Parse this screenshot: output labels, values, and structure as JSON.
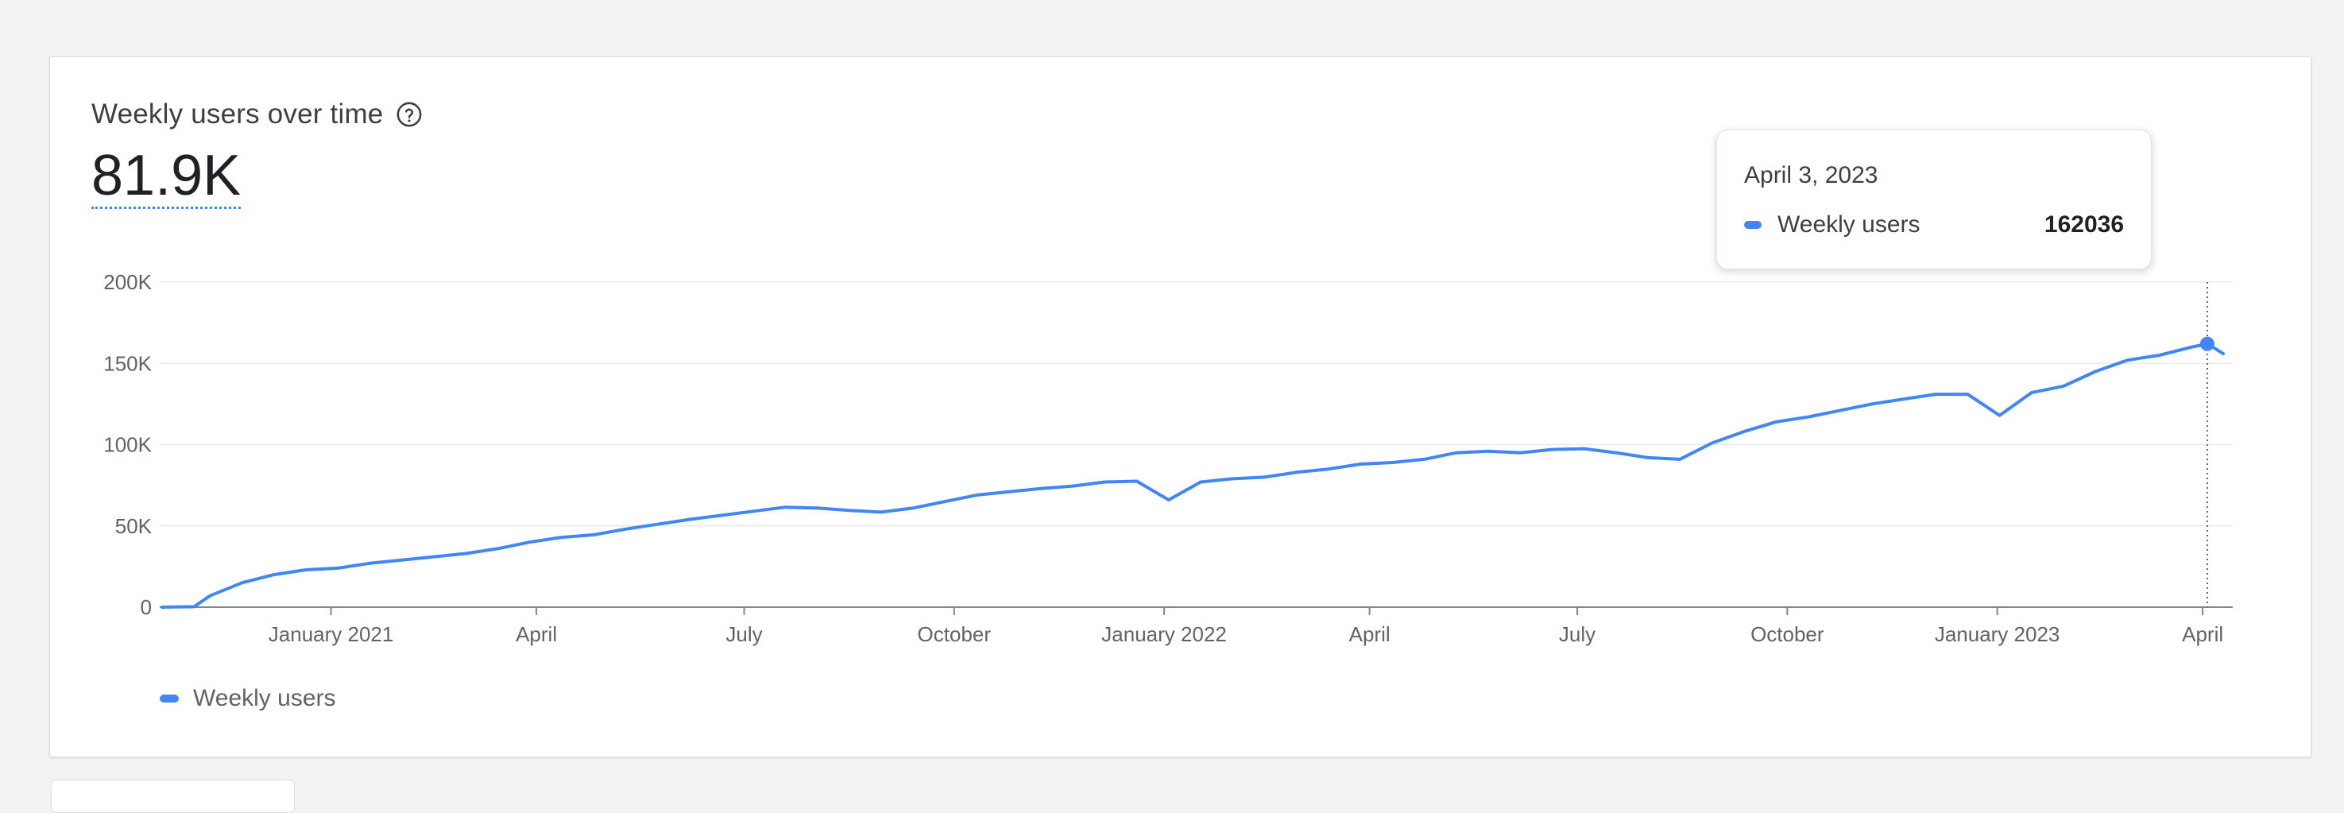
{
  "card": {
    "title": "Weekly users over time",
    "headline_value": "81.9K"
  },
  "tooltip": {
    "date": "April 3, 2023",
    "series": "Weekly users",
    "value": "162036"
  },
  "legend": {
    "label": "Weekly users"
  },
  "colors": {
    "series": "#4285f4",
    "grid": "#e8eaed",
    "axis": "#80868b"
  },
  "icons": {
    "help": "help-circle-icon"
  },
  "chart_data": {
    "type": "line",
    "ylim": [
      0,
      200000
    ],
    "y_ticks": [
      {
        "value": 0,
        "label": "0"
      },
      {
        "value": 50000,
        "label": "50K"
      },
      {
        "value": 100000,
        "label": "100K"
      },
      {
        "value": 150000,
        "label": "150K"
      },
      {
        "value": 200000,
        "label": "200K"
      }
    ],
    "x_range": [
      "2020-10-19",
      "2023-04-10"
    ],
    "x_ticks": [
      {
        "date": "2021-01-01",
        "label": "January 2021"
      },
      {
        "date": "2021-04-01",
        "label": "April"
      },
      {
        "date": "2021-07-01",
        "label": "July"
      },
      {
        "date": "2021-10-01",
        "label": "October"
      },
      {
        "date": "2022-01-01",
        "label": "January 2022"
      },
      {
        "date": "2022-04-01",
        "label": "April"
      },
      {
        "date": "2022-07-01",
        "label": "July"
      },
      {
        "date": "2022-10-01",
        "label": "October"
      },
      {
        "date": "2023-01-01",
        "label": "January 2023"
      },
      {
        "date": "2023-04-01",
        "label": "April"
      }
    ],
    "series": [
      {
        "name": "Weekly users",
        "points": [
          [
            "2020-10-19",
            0
          ],
          [
            "2020-11-02",
            300
          ],
          [
            "2020-11-09",
            7000
          ],
          [
            "2020-11-23",
            15000
          ],
          [
            "2020-12-07",
            20000
          ],
          [
            "2020-12-21",
            23000
          ],
          [
            "2021-01-04",
            24000
          ],
          [
            "2021-01-18",
            27000
          ],
          [
            "2021-02-01",
            29000
          ],
          [
            "2021-02-15",
            31000
          ],
          [
            "2021-03-01",
            33000
          ],
          [
            "2021-03-15",
            36000
          ],
          [
            "2021-03-29",
            40000
          ],
          [
            "2021-04-12",
            43000
          ],
          [
            "2021-04-26",
            44500
          ],
          [
            "2021-05-10",
            48000
          ],
          [
            "2021-05-24",
            51000
          ],
          [
            "2021-06-07",
            54000
          ],
          [
            "2021-06-21",
            56500
          ],
          [
            "2021-07-05",
            59000
          ],
          [
            "2021-07-19",
            61500
          ],
          [
            "2021-08-02",
            61000
          ],
          [
            "2021-08-16",
            59500
          ],
          [
            "2021-08-30",
            58500
          ],
          [
            "2021-09-13",
            61000
          ],
          [
            "2021-09-27",
            65000
          ],
          [
            "2021-10-11",
            69000
          ],
          [
            "2021-10-25",
            71000
          ],
          [
            "2021-11-08",
            73000
          ],
          [
            "2021-11-22",
            74500
          ],
          [
            "2021-12-06",
            77000
          ],
          [
            "2021-12-20",
            77500
          ],
          [
            "2022-01-03",
            66000
          ],
          [
            "2022-01-17",
            77000
          ],
          [
            "2022-01-31",
            79000
          ],
          [
            "2022-02-14",
            80000
          ],
          [
            "2022-02-28",
            83000
          ],
          [
            "2022-03-14",
            85000
          ],
          [
            "2022-03-28",
            88000
          ],
          [
            "2022-04-11",
            89000
          ],
          [
            "2022-04-25",
            91000
          ],
          [
            "2022-05-09",
            95000
          ],
          [
            "2022-05-23",
            96000
          ],
          [
            "2022-06-06",
            95000
          ],
          [
            "2022-06-20",
            97000
          ],
          [
            "2022-07-04",
            97500
          ],
          [
            "2022-07-18",
            95000
          ],
          [
            "2022-08-01",
            92000
          ],
          [
            "2022-08-15",
            91000
          ],
          [
            "2022-08-29",
            101000
          ],
          [
            "2022-09-12",
            108000
          ],
          [
            "2022-09-26",
            114000
          ],
          [
            "2022-10-10",
            117000
          ],
          [
            "2022-10-24",
            121000
          ],
          [
            "2022-11-07",
            125000
          ],
          [
            "2022-11-21",
            128000
          ],
          [
            "2022-12-05",
            131000
          ],
          [
            "2022-12-19",
            131000
          ],
          [
            "2023-01-02",
            118000
          ],
          [
            "2023-01-16",
            132000
          ],
          [
            "2023-01-30",
            136000
          ],
          [
            "2023-02-13",
            145000
          ],
          [
            "2023-02-27",
            152000
          ],
          [
            "2023-03-13",
            155000
          ],
          [
            "2023-03-27",
            160000
          ],
          [
            "2023-04-03",
            162036
          ],
          [
            "2023-04-10",
            156000
          ]
        ]
      }
    ],
    "highlight": {
      "date": "2023-04-03",
      "value": 162036
    }
  }
}
